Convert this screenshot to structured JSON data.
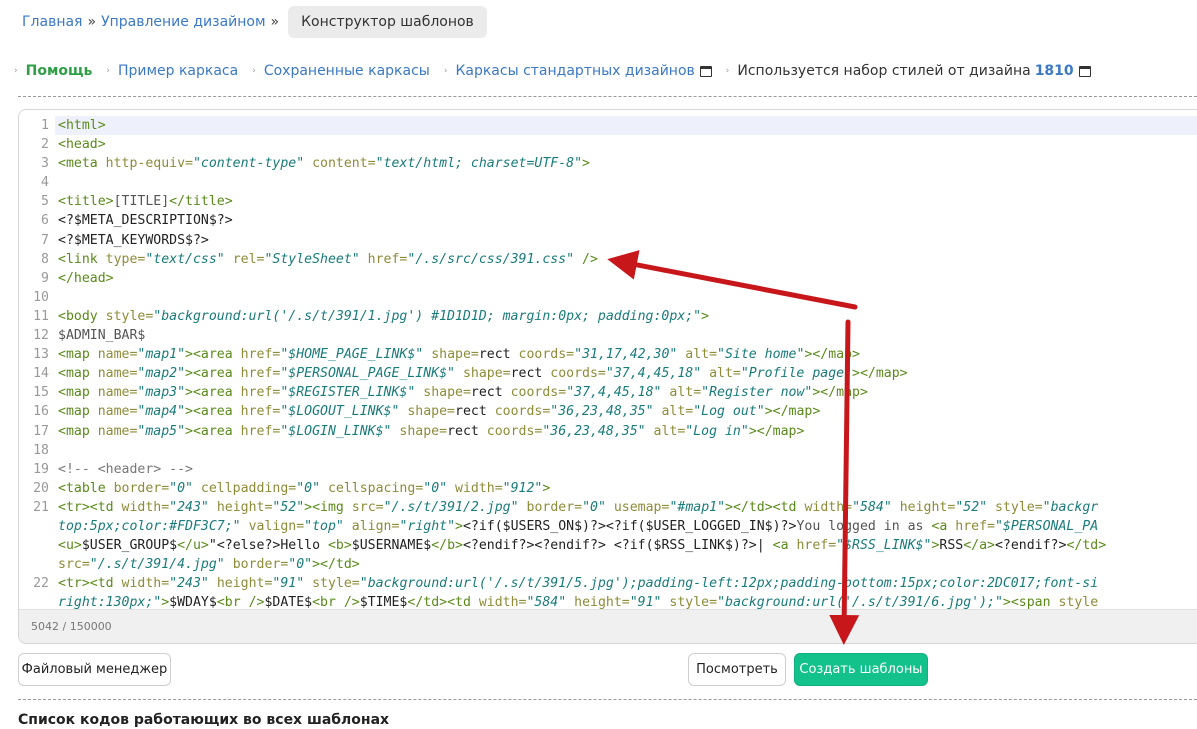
{
  "breadcrumb": {
    "home": "Главная",
    "sep": "»",
    "design": "Управление дизайном",
    "current": "Конструктор шаблонов"
  },
  "nav": {
    "help": "Помощь",
    "sample": "Пример каркаса",
    "saved": "Сохраненные каркасы",
    "standard": "Каркасы стандартных дизайнов",
    "using_text": "Используется набор стилей от дизайна",
    "design_id": "1810"
  },
  "editor": {
    "counter": "5042 / 150000",
    "lines": [
      {
        "n": "1",
        "active": true,
        "parts": [
          [
            "tag",
            "<html>"
          ]
        ]
      },
      {
        "n": "2",
        "parts": [
          [
            "tag",
            "<head>"
          ]
        ]
      },
      {
        "n": "3",
        "parts": [
          [
            "tag",
            "<meta "
          ],
          [
            "attr",
            "http-equiv="
          ],
          [
            "str",
            "\"content-type\""
          ],
          [
            "attr",
            " content="
          ],
          [
            "str",
            "\"text/html; charset=UTF-8\""
          ],
          [
            "tag",
            ">"
          ]
        ]
      },
      {
        "n": "4",
        "parts": []
      },
      {
        "n": "5",
        "parts": [
          [
            "tag",
            "<title>"
          ],
          [
            "tpl",
            "[TITLE]"
          ],
          [
            "tag",
            "</title>"
          ]
        ]
      },
      {
        "n": "6",
        "parts": [
          [
            "plain",
            "<?$META_DESCRIPTION$?>"
          ]
        ]
      },
      {
        "n": "7",
        "parts": [
          [
            "plain",
            "<?$META_KEYWORDS$?>"
          ]
        ]
      },
      {
        "n": "8",
        "parts": [
          [
            "tag",
            "<link "
          ],
          [
            "attr",
            "type="
          ],
          [
            "str",
            "\"text/css\""
          ],
          [
            "attr",
            " rel="
          ],
          [
            "str",
            "\"StyleSheet\""
          ],
          [
            "attr",
            " href="
          ],
          [
            "str",
            "\"/.s/src/css/391.css\""
          ],
          [
            "tag",
            " />"
          ]
        ]
      },
      {
        "n": "9",
        "parts": [
          [
            "tag",
            "</head>"
          ]
        ]
      },
      {
        "n": "10",
        "parts": []
      },
      {
        "n": "11",
        "parts": [
          [
            "tag",
            "<body "
          ],
          [
            "attr",
            "style="
          ],
          [
            "str",
            "\"background:url('/.s/t/391/1.jpg') #1D1D1D; margin:0px; padding:0px;\""
          ],
          [
            "tag",
            ">"
          ]
        ]
      },
      {
        "n": "12",
        "parts": [
          [
            "tpl",
            "$ADMIN_BAR$"
          ]
        ]
      },
      {
        "n": "13",
        "parts": [
          [
            "tag",
            "<map "
          ],
          [
            "attr",
            "name="
          ],
          [
            "str",
            "\"map1\""
          ],
          [
            "tag",
            "><area "
          ],
          [
            "attr",
            "href="
          ],
          [
            "str",
            "\"$HOME_PAGE_LINK$\""
          ],
          [
            "attr",
            " shape="
          ],
          [
            "plain",
            "rect"
          ],
          [
            "attr",
            " coords="
          ],
          [
            "str",
            "\"31,17,42,30\""
          ],
          [
            "attr",
            " alt="
          ],
          [
            "str",
            "\"Site home\""
          ],
          [
            "tag",
            "></map>"
          ]
        ]
      },
      {
        "n": "14",
        "parts": [
          [
            "tag",
            "<map "
          ],
          [
            "attr",
            "name="
          ],
          [
            "str",
            "\"map2\""
          ],
          [
            "tag",
            "><area "
          ],
          [
            "attr",
            "href="
          ],
          [
            "str",
            "\"$PERSONAL_PAGE_LINK$\""
          ],
          [
            "attr",
            " shape="
          ],
          [
            "plain",
            "rect"
          ],
          [
            "attr",
            " coords="
          ],
          [
            "str",
            "\"37,4,45,18\""
          ],
          [
            "attr",
            " alt="
          ],
          [
            "str",
            "\"Profile page\""
          ],
          [
            "tag",
            "></map>"
          ]
        ]
      },
      {
        "n": "15",
        "parts": [
          [
            "tag",
            "<map "
          ],
          [
            "attr",
            "name="
          ],
          [
            "str",
            "\"map3\""
          ],
          [
            "tag",
            "><area "
          ],
          [
            "attr",
            "href="
          ],
          [
            "str",
            "\"$REGISTER_LINK$\""
          ],
          [
            "attr",
            " shape="
          ],
          [
            "plain",
            "rect"
          ],
          [
            "attr",
            " coords="
          ],
          [
            "str",
            "\"37,4,45,18\""
          ],
          [
            "attr",
            " alt="
          ],
          [
            "str",
            "\"Register now\""
          ],
          [
            "tag",
            "></map>"
          ]
        ]
      },
      {
        "n": "16",
        "parts": [
          [
            "tag",
            "<map "
          ],
          [
            "attr",
            "name="
          ],
          [
            "str",
            "\"map4\""
          ],
          [
            "tag",
            "><area "
          ],
          [
            "attr",
            "href="
          ],
          [
            "str",
            "\"$LOGOUT_LINK$\""
          ],
          [
            "attr",
            " shape="
          ],
          [
            "plain",
            "rect"
          ],
          [
            "attr",
            " coords="
          ],
          [
            "str",
            "\"36,23,48,35\""
          ],
          [
            "attr",
            " alt="
          ],
          [
            "str",
            "\"Log out\""
          ],
          [
            "tag",
            "></map>"
          ]
        ]
      },
      {
        "n": "17",
        "parts": [
          [
            "tag",
            "<map "
          ],
          [
            "attr",
            "name="
          ],
          [
            "str",
            "\"map5\""
          ],
          [
            "tag",
            "><area "
          ],
          [
            "attr",
            "href="
          ],
          [
            "str",
            "\"$LOGIN_LINK$\""
          ],
          [
            "attr",
            " shape="
          ],
          [
            "plain",
            "rect"
          ],
          [
            "attr",
            " coords="
          ],
          [
            "str",
            "\"36,23,48,35\""
          ],
          [
            "attr",
            " alt="
          ],
          [
            "str",
            "\"Log in\""
          ],
          [
            "tag",
            "></map>"
          ]
        ]
      },
      {
        "n": "18",
        "parts": []
      },
      {
        "n": "19",
        "parts": [
          [
            "cmt",
            "<!-- <header> -->"
          ]
        ]
      },
      {
        "n": "20",
        "parts": [
          [
            "tag",
            "<table "
          ],
          [
            "attr",
            "border="
          ],
          [
            "str",
            "\"0\""
          ],
          [
            "attr",
            " cellpadding="
          ],
          [
            "str",
            "\"0\""
          ],
          [
            "attr",
            " cellspacing="
          ],
          [
            "str",
            "\"0\""
          ],
          [
            "attr",
            " width="
          ],
          [
            "str",
            "\"912\""
          ],
          [
            "tag",
            ">"
          ]
        ]
      },
      {
        "n": "21",
        "parts": [
          [
            "tag",
            "<tr><td "
          ],
          [
            "attr",
            "width="
          ],
          [
            "str",
            "\"243\""
          ],
          [
            "attr",
            " height="
          ],
          [
            "str",
            "\"52\""
          ],
          [
            "tag",
            "><img "
          ],
          [
            "attr",
            "src="
          ],
          [
            "str",
            "\"/.s/t/391/2.jpg\""
          ],
          [
            "attr",
            " border="
          ],
          [
            "str",
            "\"0\""
          ],
          [
            "attr",
            " usemap="
          ],
          [
            "str",
            "\"#map1\""
          ],
          [
            "tag",
            "></td><td "
          ],
          [
            "attr",
            "width="
          ],
          [
            "str",
            "\"584\""
          ],
          [
            "attr",
            " height="
          ],
          [
            "str",
            "\"52\""
          ],
          [
            "attr",
            " style="
          ],
          [
            "str",
            "\"backgr"
          ]
        ]
      },
      {
        "n": "",
        "parts": [
          [
            "str",
            "top:5px;color:#FDF3C7;\""
          ],
          [
            "attr",
            " valign="
          ],
          [
            "str",
            "\"top\""
          ],
          [
            "attr",
            " align="
          ],
          [
            "str",
            "\"right\""
          ],
          [
            "tag",
            ">"
          ],
          [
            "plain",
            "<?if($USERS_ON$)?><?if($USER_LOGGED_IN$)?>"
          ],
          [
            "tpl",
            "You logged in as "
          ],
          [
            "tag",
            "<a "
          ],
          [
            "attr",
            "href="
          ],
          [
            "str",
            "\"$PERSONAL_PA"
          ]
        ]
      },
      {
        "n": "",
        "parts": [
          [
            "tag",
            "<u>"
          ],
          [
            "plain",
            "$USER_GROUP$"
          ],
          [
            "tag",
            "</u>"
          ],
          [
            "plain",
            "\"<?else?>Hello "
          ],
          [
            "tag",
            "<b>"
          ],
          [
            "plain",
            "$USERNAME$"
          ],
          [
            "tag",
            "</b>"
          ],
          [
            "plain",
            "<?endif?><?endif?> <?if($RSS_LINK$)?>| "
          ],
          [
            "tag",
            "<a "
          ],
          [
            "attr",
            "href="
          ],
          [
            "str",
            "\"$RSS_LINK$\""
          ],
          [
            "tag",
            ">"
          ],
          [
            "plain",
            "RSS"
          ],
          [
            "tag",
            "</a>"
          ],
          [
            "plain",
            "<?endif?>"
          ],
          [
            "tag",
            "</td>"
          ]
        ]
      },
      {
        "n": "",
        "parts": [
          [
            "attr",
            "src="
          ],
          [
            "str",
            "\"/.s/t/391/4.jpg\""
          ],
          [
            "attr",
            " border="
          ],
          [
            "str",
            "\"0\""
          ],
          [
            "tag",
            "></td>"
          ]
        ]
      },
      {
        "n": "22",
        "parts": [
          [
            "tag",
            "<tr><td "
          ],
          [
            "attr",
            "width="
          ],
          [
            "str",
            "\"243\""
          ],
          [
            "attr",
            " height="
          ],
          [
            "str",
            "\"91\""
          ],
          [
            "attr",
            " style="
          ],
          [
            "str",
            "\"background:url('/.s/t/391/5.jpg');padding-left:12px;padding-bottom:15px;color:2DC017;font-si"
          ]
        ]
      },
      {
        "n": "",
        "parts": [
          [
            "str",
            "right:130px;\""
          ],
          [
            "tag",
            ">"
          ],
          [
            "plain",
            "$WDAY$"
          ],
          [
            "tag",
            "<br />"
          ],
          [
            "plain",
            "$DATE$"
          ],
          [
            "tag",
            "<br />"
          ],
          [
            "plain",
            "$TIME$"
          ],
          [
            "tag",
            "</td><td "
          ],
          [
            "attr",
            "width="
          ],
          [
            "str",
            "\"584\""
          ],
          [
            "attr",
            " height="
          ],
          [
            "str",
            "\"91\""
          ],
          [
            "attr",
            " style="
          ],
          [
            "str",
            "\"background:url('/.s/t/391/6.jpg');\""
          ],
          [
            "tag",
            "><span "
          ],
          [
            "attr",
            "style"
          ]
        ]
      }
    ]
  },
  "buttons": {
    "file_manager": "Файловый менеджер",
    "preview": "Посмотреть",
    "create": "Создать шаблоны"
  },
  "section": {
    "title": "Список кодов работающих во всех шаблонах"
  },
  "colors": {
    "accent_green": "#13c18a",
    "link_blue": "#3b79c4",
    "annotation_red": "#c8171b"
  }
}
